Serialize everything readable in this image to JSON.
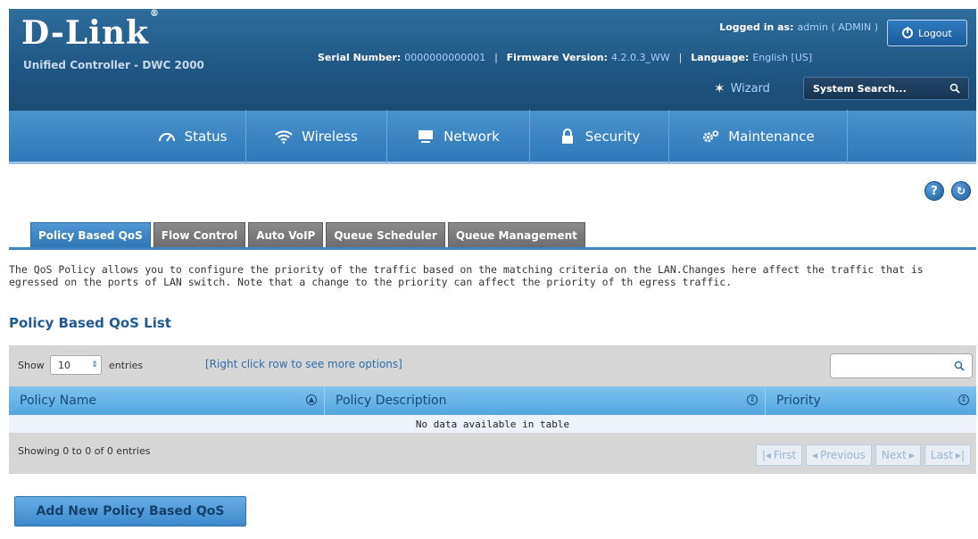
{
  "brand": {
    "logo": "D-Link",
    "logo_mark": "®",
    "subtitle": "Unified Controller - DWC 2000"
  },
  "header": {
    "logged_in_label": "Logged in as:",
    "logged_in_value": "admin ( ADMIN )",
    "logout_label": "Logout",
    "serial_label": "Serial Number:",
    "serial_value": "0000000000001",
    "firmware_label": "Firmware Version:",
    "firmware_value": "4.2.0.3_WW",
    "language_label": "Language:",
    "language_value": "English [US]",
    "separator": "|",
    "wizard_label": "Wizard",
    "search_placeholder": "System Search..."
  },
  "nav": [
    {
      "label": "Status",
      "icon": "dashboard-icon"
    },
    {
      "label": "Wireless",
      "icon": "wifi-icon"
    },
    {
      "label": "Network",
      "icon": "monitor-icon"
    },
    {
      "label": "Security",
      "icon": "lock-icon"
    },
    {
      "label": "Maintenance",
      "icon": "gear-icon"
    }
  ],
  "help": {
    "q": "?",
    "r": "↻"
  },
  "tabs": [
    {
      "label": "Policy Based QoS",
      "active": true
    },
    {
      "label": "Flow Control",
      "active": false
    },
    {
      "label": "Auto VoIP",
      "active": false
    },
    {
      "label": "Queue Scheduler",
      "active": false
    },
    {
      "label": "Queue Management",
      "active": false
    }
  ],
  "description": "The QoS Policy allows you to configure the priority of the traffic based on the matching criteria on the LAN.Changes here affect the traffic that is egressed on the ports of LAN switch. Note that a change to the priority can affect the priority of th egress traffic.",
  "section_title": "Policy Based QoS List",
  "table": {
    "show_label": "Show",
    "entries_value": "10",
    "entries_label": "entries",
    "hint": "[Right click row to see more options]",
    "columns": [
      "Policy Name",
      "Policy Description",
      "Priority"
    ],
    "empty_text": "No data available in table",
    "showing_text": "Showing 0 to 0 of 0 entries",
    "pager": {
      "first": "First",
      "previous": "Previous",
      "next": "Next",
      "last": "Last"
    }
  },
  "add_button": "Add New Policy Based QoS",
  "colors": {
    "header": "#1f5683",
    "nav": "#3a84c4",
    "tab_active": "#3b84c3",
    "tab_inactive": "#777777",
    "table_header": "#6bb6ea"
  }
}
